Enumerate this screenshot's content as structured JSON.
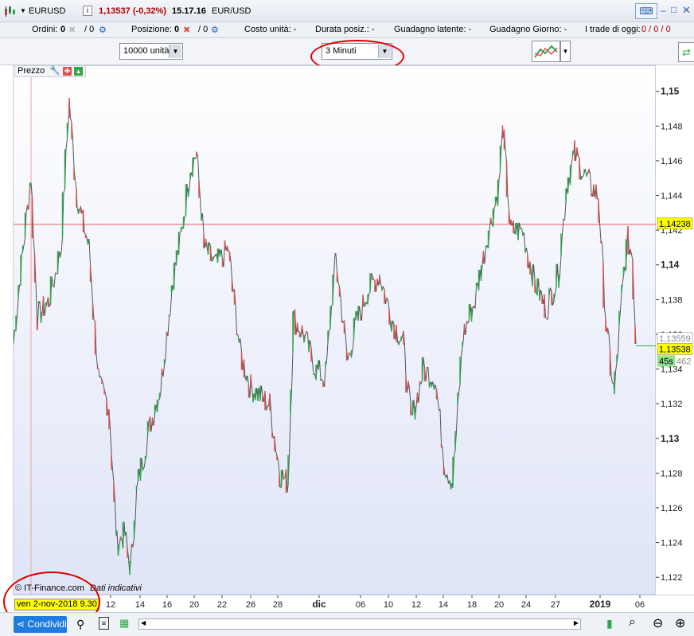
{
  "window": {
    "symbol": "EURUSD",
    "price_change": "1,13537 (-0,32%)",
    "time": "15.17.16",
    "pair": "EUR/USD"
  },
  "info": {
    "orders_label": "Ordini:",
    "orders_value": "0",
    "orders_value2": "/ 0",
    "positions_label": "Posizione:",
    "positions_value": "0",
    "positions_value2": "/ 0",
    "unit_cost": "Costo unità: -",
    "duration": "Durata posiz.: -",
    "latent_gain": "Guadagno latente: -",
    "daily_gain": "Guadagno Giorno: -",
    "trades_label": "I trade di oggi:",
    "trades_value": "0 / 0 / 0"
  },
  "toolbar": {
    "units_select": "10000 unità",
    "timeframe_select": "3 Minuti"
  },
  "chart": {
    "panel_label": "Prezzo",
    "copyright": "© IT-Finance.com",
    "note": "Dati indicativi",
    "cursor_date": "ven 2-nov-2018 9.30",
    "share_label": "Condividi",
    "y_ticks": [
      "1,15",
      "1,148",
      "1,146",
      "1,144",
      "1,142",
      "1,14",
      "1,138",
      "1,136",
      "1,134",
      "1,132",
      "1,13",
      "1,128",
      "1,126",
      "1,124",
      "1,122"
    ],
    "price_line_label": "1,14238",
    "current_label": "1,13538",
    "ask_label": "1,13559",
    "bid_label": "462",
    "countdown": "45s",
    "x_ticks": [
      "12",
      "14",
      "16",
      "20",
      "22",
      "26",
      "28",
      "dic",
      "06",
      "10",
      "12",
      "14",
      "18",
      "20",
      "24",
      "27",
      "2019",
      "06"
    ]
  },
  "colors": {
    "up_candle": "#2ea84a",
    "down_candle": "#d9534f",
    "price_line": "#e06060",
    "accent": "#1e7be0"
  }
}
